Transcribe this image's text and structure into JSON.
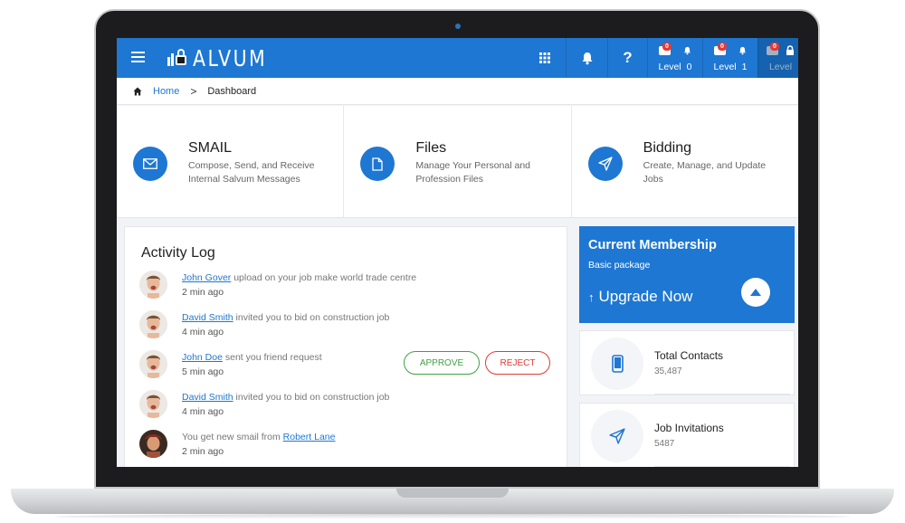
{
  "header": {
    "logo_text": "ALVUM",
    "levels": [
      {
        "label": "Level",
        "number": "0",
        "badge": "0"
      },
      {
        "label": "Level",
        "number": "1",
        "badge": "0"
      },
      {
        "label": "Level",
        "number": "",
        "badge": "0"
      }
    ],
    "help_label": "?",
    "accent_color": "#1e77d2"
  },
  "breadcrumb": {
    "home": "Home",
    "current": "Dashboard",
    "separator": ">"
  },
  "features": [
    {
      "title": "SMAIL",
      "description": "Compose, Send, and Receive Internal Salvum Messages",
      "icon": "mail-icon"
    },
    {
      "title": "Files",
      "description": "Manage Your Personal and Profession Files",
      "icon": "file-icon"
    },
    {
      "title": "Bidding",
      "description": "Create, Manage, and Update Jobs",
      "icon": "send-icon"
    }
  ],
  "activity": {
    "title": "Activity Log",
    "items": [
      {
        "user": "John Gover",
        "text": " upload on your job make world trade centre",
        "time": "2 min ago"
      },
      {
        "user": "David Smith",
        "text": " invited you to bid on construction job",
        "time": "4 min ago"
      },
      {
        "user": "John Doe",
        "text": " sent you friend request",
        "time": "5 min ago",
        "approve": "APPROVE",
        "reject": "REJECT"
      },
      {
        "user": "David Smith",
        "text": " invited you to bid on construction job",
        "time": "4 min ago"
      },
      {
        "prefix": "You get new smail from ",
        "user": "Robert Lane",
        "time": "2 min ago"
      }
    ]
  },
  "membership": {
    "title": "Current Membership",
    "package": "Basic package",
    "upgrade": "Upgrade Now",
    "arrow": "↑"
  },
  "stats": [
    {
      "label": "Total Contacts",
      "value": "35,487",
      "icon": "phone-icon"
    },
    {
      "label": "Job Invitations",
      "value": "5487",
      "icon": "send-icon"
    }
  ]
}
